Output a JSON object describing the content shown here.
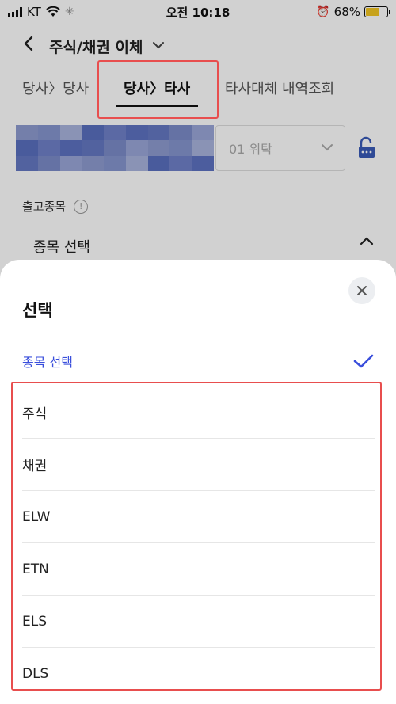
{
  "status_bar": {
    "carrier": "KT",
    "time": "오전 10:18",
    "battery": "68%",
    "battery_level": 0.68
  },
  "header": {
    "title": "주식/채권 이체"
  },
  "tabs": [
    {
      "label": "당사〉당사"
    },
    {
      "label": "당사〉타사"
    },
    {
      "label": "타사대체 내역조회"
    }
  ],
  "account": {
    "select_value": "01 위탁"
  },
  "section": {
    "label": "출고종목",
    "stock_select_label": "종목 선택"
  },
  "sheet": {
    "title": "선택",
    "selected_option": "종목 선택",
    "options": [
      "주식",
      "채권",
      "ELW",
      "ETN",
      "ELS",
      "DLS"
    ]
  },
  "colors": {
    "accent": "#3a4fdc",
    "highlight": "#e84e4e",
    "battery": "#f3c623"
  }
}
